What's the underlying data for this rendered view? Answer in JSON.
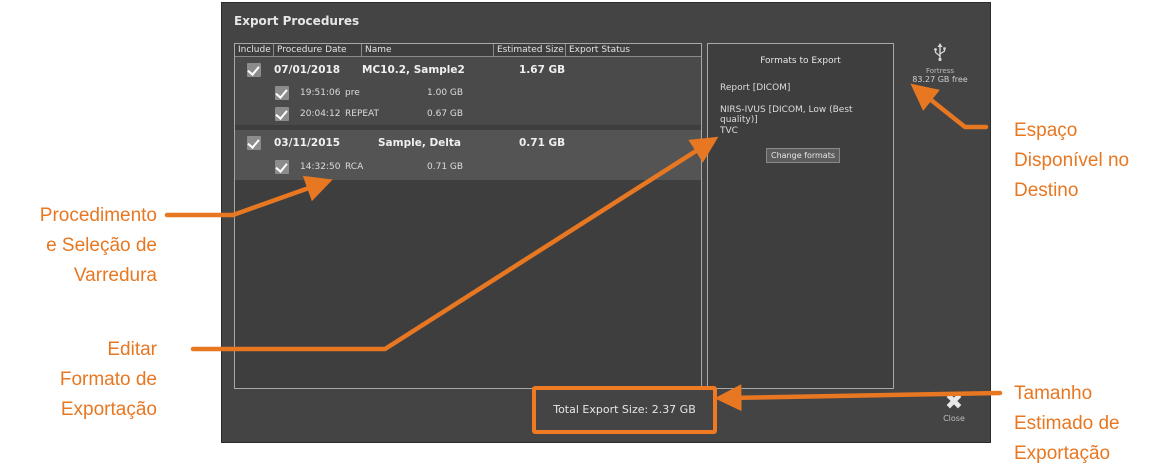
{
  "dialog": {
    "title": "Export Procedures",
    "columns": [
      "Include",
      "Procedure Date",
      "Name",
      "Estimated Size",
      "Export Status"
    ],
    "procedures": [
      {
        "date": "07/01/2018",
        "name": "MC10.2, Sample2",
        "size": "1.67 GB",
        "checked": true,
        "scans": [
          {
            "time": "19:51:06",
            "name": "pre",
            "size": "1.00 GB",
            "checked": true
          },
          {
            "time": "20:04:12",
            "name": "REPEAT",
            "size": "0.67 GB",
            "checked": true
          }
        ]
      },
      {
        "date": "03/11/2015",
        "name": "Sample, Delta",
        "size": "0.71 GB",
        "checked": true,
        "scans": [
          {
            "time": "14:32:50",
            "name": "RCA",
            "size": "0.71 GB",
            "checked": true
          }
        ]
      }
    ],
    "formats": {
      "heading": "Formats to Export",
      "items": [
        "Report [DICOM]",
        "NIRS-IVUS [DICOM, Low (Best quality)]",
        "TVC"
      ],
      "change_button": "Change formats"
    },
    "destination": {
      "name": "Fortress",
      "free": "83.27 GB free",
      "icon": "usb-icon"
    },
    "total_label": "Total Export Size: 2.37 GB",
    "close_label": "Close",
    "close_icon": "close-x-icon"
  },
  "callouts": {
    "procedure_selection": [
      "Procedimento",
      "e Seleção de",
      "Varredura"
    ],
    "edit_format": [
      "Editar",
      "Formato de",
      "Exportação"
    ],
    "free_space": [
      "Espaço",
      "Disponível no",
      "Destino"
    ],
    "estimated_size": [
      "Tamanho",
      "Estimado de",
      "Exportação"
    ]
  },
  "colors": {
    "accent": "#e87722",
    "panel": "#444444",
    "highlight_border": "#ef7a22"
  }
}
